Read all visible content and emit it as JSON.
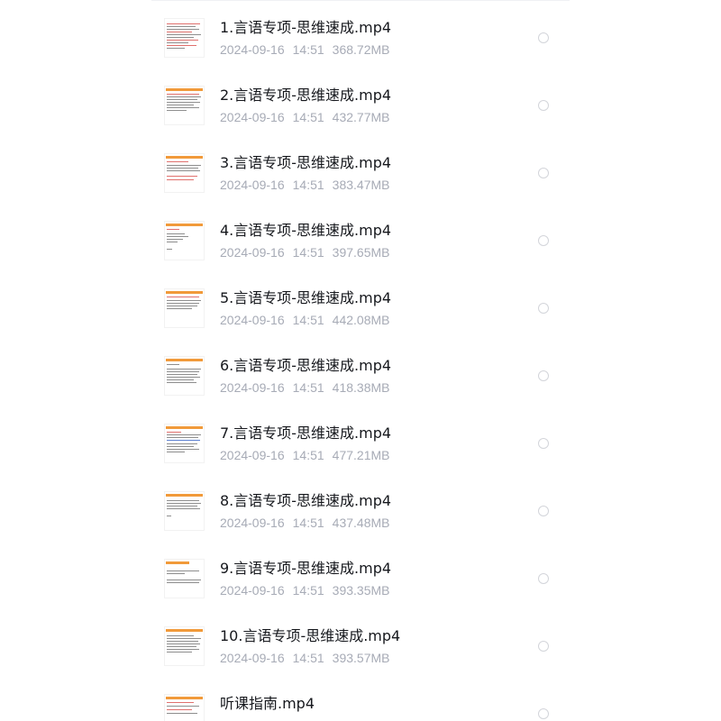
{
  "files": [
    {
      "name": "1.言语专项-思维速成.mp4",
      "date": "2024-09-16",
      "time": "14:51",
      "size": "368.72MB",
      "thumb_icon": "video-thumbnail-icon"
    },
    {
      "name": "2.言语专项-思维速成.mp4",
      "date": "2024-09-16",
      "time": "14:51",
      "size": "432.77MB",
      "thumb_icon": "video-thumbnail-icon"
    },
    {
      "name": "3.言语专项-思维速成.mp4",
      "date": "2024-09-16",
      "time": "14:51",
      "size": "383.47MB",
      "thumb_icon": "video-thumbnail-icon"
    },
    {
      "name": "4.言语专项-思维速成.mp4",
      "date": "2024-09-16",
      "time": "14:51",
      "size": "397.65MB",
      "thumb_icon": "video-thumbnail-icon"
    },
    {
      "name": "5.言语专项-思维速成.mp4",
      "date": "2024-09-16",
      "time": "14:51",
      "size": "442.08MB",
      "thumb_icon": "video-thumbnail-icon"
    },
    {
      "name": "6.言语专项-思维速成.mp4",
      "date": "2024-09-16",
      "time": "14:51",
      "size": "418.38MB",
      "thumb_icon": "video-thumbnail-icon"
    },
    {
      "name": "7.言语专项-思维速成.mp4",
      "date": "2024-09-16",
      "time": "14:51",
      "size": "477.21MB",
      "thumb_icon": "video-thumbnail-icon"
    },
    {
      "name": "8.言语专项-思维速成.mp4",
      "date": "2024-09-16",
      "time": "14:51",
      "size": "437.48MB",
      "thumb_icon": "video-thumbnail-icon"
    },
    {
      "name": "9.言语专项-思维速成.mp4",
      "date": "2024-09-16",
      "time": "14:51",
      "size": "393.35MB",
      "thumb_icon": "video-thumbnail-icon"
    },
    {
      "name": "10.言语专项-思维速成.mp4",
      "date": "2024-09-16",
      "time": "14:51",
      "size": "393.57MB",
      "thumb_icon": "video-thumbnail-icon"
    },
    {
      "name": "听课指南.mp4",
      "date": "",
      "time": "",
      "size": "",
      "thumb_icon": "video-thumbnail-icon"
    }
  ],
  "colors": {
    "name_text": "#16181d",
    "meta_text": "#a7abb6",
    "radio_border": "#d3d5da",
    "thumb_accent": "#f19a3a"
  },
  "icons": {
    "select": "radio-circle-icon"
  }
}
